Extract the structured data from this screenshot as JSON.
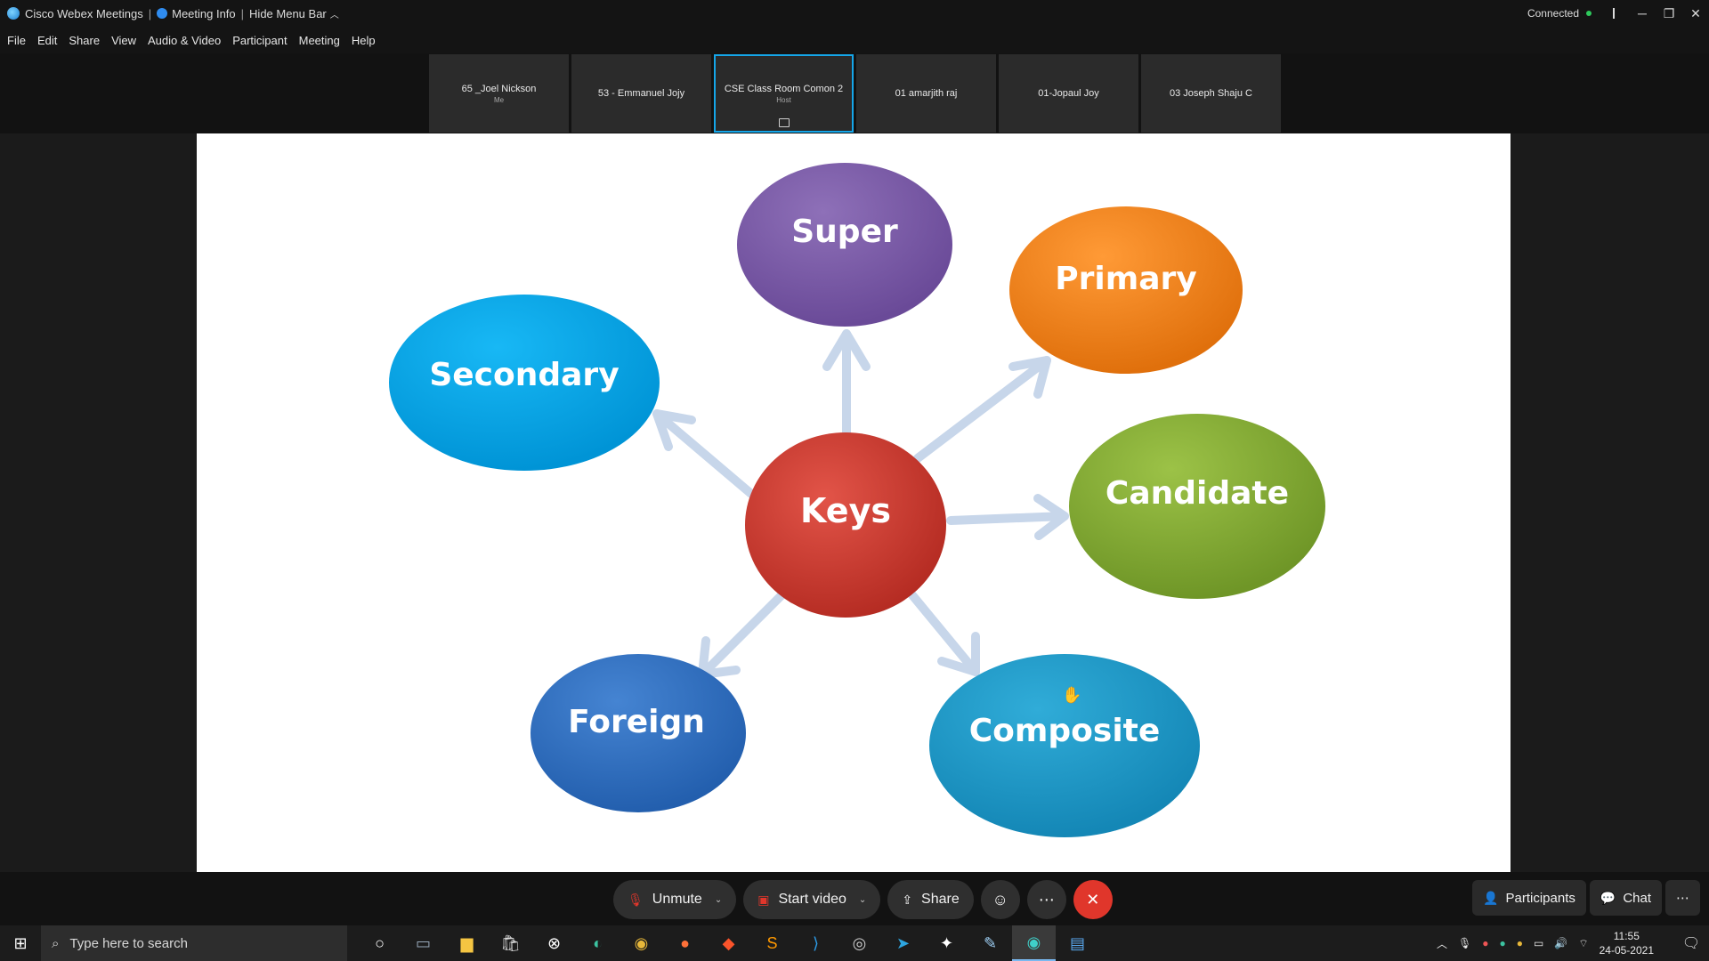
{
  "titlebar": {
    "app_title": "Cisco Webex Meetings",
    "meeting_info": "Meeting Info",
    "hide_menu": "Hide Menu Bar",
    "status": "Connected",
    "minimize": "─",
    "restore": "❐",
    "close": "✕"
  },
  "menu": [
    "File",
    "Edit",
    "Share",
    "View",
    "Audio & Video",
    "Participant",
    "Meeting",
    "Help"
  ],
  "participants": [
    {
      "name": "65 _Joel Nickson",
      "sub": "Me"
    },
    {
      "name": "53 - Emmanuel Jojy",
      "sub": ""
    },
    {
      "name": "CSE Class Room Comon 2",
      "sub": "Host"
    },
    {
      "name": "01 amarjith raj",
      "sub": ""
    },
    {
      "name": "01-Jopaul Joy",
      "sub": ""
    },
    {
      "name": "03 Joseph Shaju C",
      "sub": ""
    }
  ],
  "diagram": {
    "center": "Keys",
    "nodes": {
      "super": "Super",
      "primary": "Primary",
      "secondary": "Secondary",
      "candidate": "Candidate",
      "foreign": "Foreign",
      "composite": "Composite"
    },
    "colors": {
      "center": "#c9352b",
      "super": "#7b5aa6",
      "primary": "#f07f16",
      "secondary": "#06a7e8",
      "candidate": "#86ac34",
      "foreign": "#2f6fbe",
      "composite": "#1f9ac9",
      "arrow": "#c7d6ea"
    }
  },
  "controls": {
    "unmute": "Unmute",
    "start_video": "Start video",
    "share": "Share",
    "participants": "Participants",
    "chat": "Chat"
  },
  "taskbar": {
    "search_placeholder": "Type here to search",
    "time": "11:55",
    "date": "24-05-2021"
  }
}
